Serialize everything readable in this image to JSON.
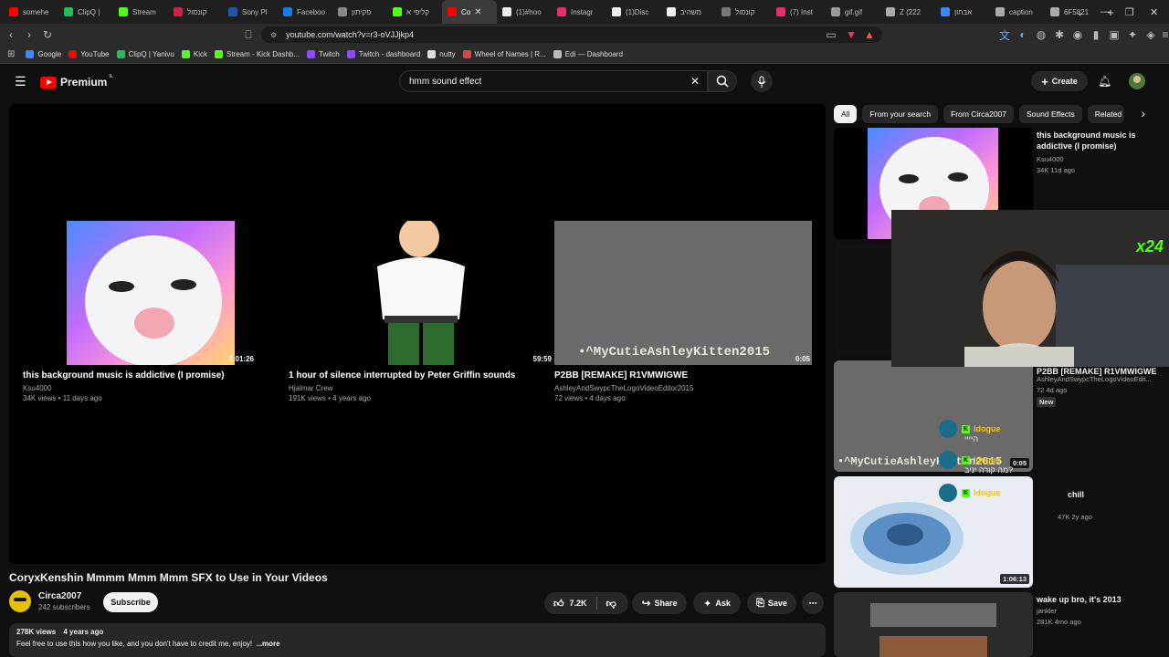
{
  "browser": {
    "tabs": [
      {
        "label": "somehe",
        "color": "#ff0000"
      },
      {
        "label": "ClipQ |",
        "color": "#22bb55"
      },
      {
        "label": "Stream",
        "color": "#53fc18"
      },
      {
        "label": "קונסול",
        "color": "#cc2244"
      },
      {
        "label": "Sony Pl",
        "color": "#2255aa"
      },
      {
        "label": "Faceboo",
        "color": "#1877f2"
      },
      {
        "label": "פקיתון",
        "color": "#888888"
      },
      {
        "label": "קליפי א",
        "color": "#53fc18"
      },
      {
        "label": "Co",
        "color": "#ff0000",
        "active": true
      },
      {
        "label": "(1)#hoo",
        "color": "#eeeeee"
      },
      {
        "label": "Instagr",
        "color": "#e1306c"
      },
      {
        "label": "(1)Disc",
        "color": "#eeeeee"
      },
      {
        "label": "משהיב",
        "color": "#eeeeee"
      },
      {
        "label": "קונסול",
        "color": "#777777"
      },
      {
        "label": "(7) Inst",
        "color": "#e1306c"
      },
      {
        "label": "gif.gif",
        "color": "#999999"
      },
      {
        "label": "Z (222",
        "color": "#aaaaaa"
      },
      {
        "label": "אבחון",
        "color": "#4285f4"
      },
      {
        "label": "caption",
        "color": "#aaaaaa"
      },
      {
        "label": "6F5821",
        "color": "#aaaaaa"
      }
    ],
    "url": "youtube.com/watch?v=r3-oVJJjkp4",
    "bookmarks": [
      {
        "label": "Google",
        "color": "#4285f4"
      },
      {
        "label": "YouTube",
        "color": "#ff0000"
      },
      {
        "label": "ClipQ | Yanivu",
        "color": "#22bb55"
      },
      {
        "label": "Kick",
        "color": "#53fc18"
      },
      {
        "label": "Stream - Kick Dashb...",
        "color": "#53fc18"
      },
      {
        "label": "Twitch",
        "color": "#9146ff"
      },
      {
        "label": "Twitch - dashboard",
        "color": "#9146ff"
      },
      {
        "label": "nutty",
        "color": "#dddddd"
      },
      {
        "label": "Wheel of Names | R...",
        "color": "#dd4444"
      },
      {
        "label": "Edi — Dashboard",
        "color": "#bbbbbb"
      }
    ]
  },
  "youtube": {
    "brand": "Premium",
    "region": "IL",
    "search_query": "hmm sound effect",
    "create_label": "Create"
  },
  "endcards": [
    {
      "title": "this background music is addictive (I promise)",
      "channel": "Ksu4000",
      "meta": "34K views • 11 days ago",
      "duration": "1:01:26"
    },
    {
      "title": "1 hour of silence interrupted by Peter Griffin sounds",
      "channel": "Hjalmar Crew",
      "meta": "191K views • 4 years ago",
      "duration": "59:59"
    },
    {
      "title": "P2BB [REMAKE] R1VMWIGWE",
      "channel": "AshleyAndSwypcTheLogoVideoEditor2015",
      "meta": "72 views • 4 days ago",
      "duration": "0:05",
      "overlay": "•^MyCutieAshleyKitten2015"
    }
  ],
  "video": {
    "title": "CoryxKenshin Mmmm Mmm Mmm SFX to Use in Your Videos",
    "channel": "Circa2007",
    "subscribers": "242 subscribers",
    "subscribe_label": "Subscribe",
    "likes": "7.2K",
    "share_label": "Share",
    "ask_label": "Ask",
    "save_label": "Save",
    "views": "278K views",
    "age": "4 years ago",
    "description": "Feel free to use this how you like, and you don't have to credit me, enjoy!",
    "more_label": "...more"
  },
  "chips": [
    "All",
    "From your search",
    "From Circa2007",
    "Sound Effects",
    "Related"
  ],
  "recommendations": [
    {
      "title": "this background music is addictive (I promise)",
      "channel": "Ksu4000",
      "meta": "34K  11d ago"
    },
    {
      "title": "P2BB [REMAKE] R1VMWIGWE",
      "channel": "AshleyAndSwypcTheLogoVideoEdit...",
      "meta": "72  4d ago",
      "badge": "New",
      "duration": "0:05"
    },
    {
      "title": "chill",
      "channel": "",
      "meta": "47K  2y ago",
      "duration": "1:06:13"
    },
    {
      "title": "wake up bro, it's 2013",
      "channel": "jankler",
      "meta": "281K  4mo ago"
    }
  ],
  "chat": [
    {
      "user": "Idogue",
      "text": "היייי",
      "color": "#f0c419"
    },
    {
      "user": "Idogue",
      "text": "מה קורה יניב?",
      "color": "#f0c419"
    },
    {
      "user": "Idogue",
      "text": "",
      "color": "#f0c419"
    }
  ],
  "overlay_badge": "x24"
}
